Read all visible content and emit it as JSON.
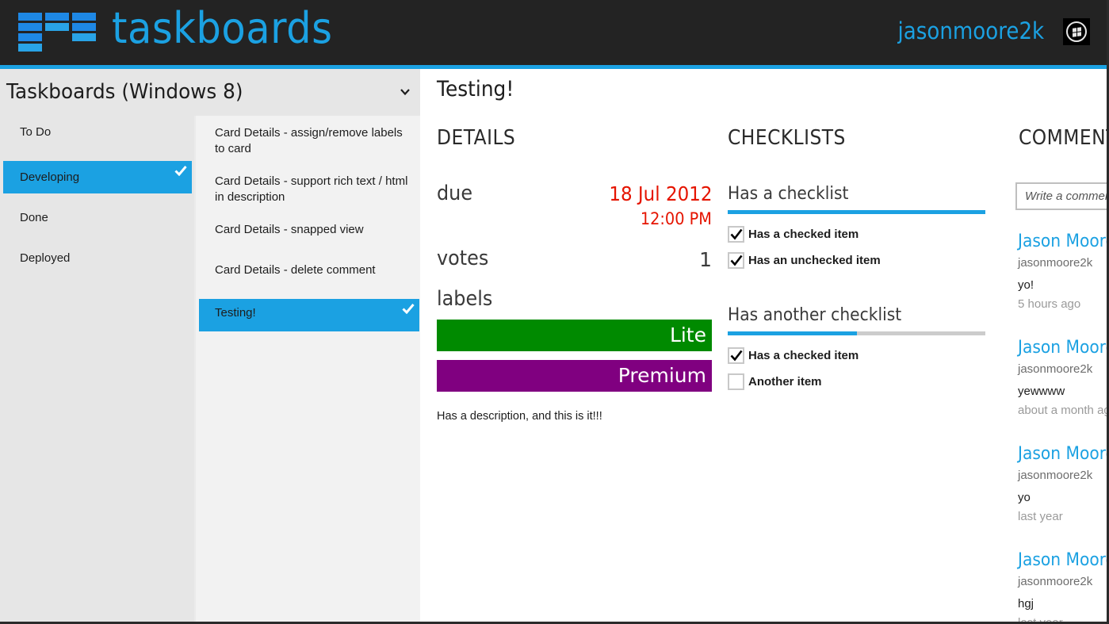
{
  "header": {
    "app_title": "taskboards",
    "username": "jasonmoore2k",
    "accent_color": "#1ba1e2",
    "avatar_icon": "windows-logo-icon"
  },
  "board": {
    "title": "Taskboards (Windows 8)",
    "dropdown_icon": "chevron-down-icon"
  },
  "lists": [
    {
      "label": "To Do",
      "selected": false
    },
    {
      "label": "Developing",
      "selected": true
    },
    {
      "label": "Done",
      "selected": false
    },
    {
      "label": "Deployed",
      "selected": false
    }
  ],
  "cards": [
    {
      "label": "Card Details - assign/remove labels to card",
      "selected": false
    },
    {
      "label": "Card Details - support rich text / html in description",
      "selected": false
    },
    {
      "label": "Card Details - snapped view",
      "selected": false
    },
    {
      "label": "Card Details - delete comment",
      "selected": false
    },
    {
      "label": "Testing!",
      "selected": true
    }
  ],
  "card": {
    "title": "Testing!",
    "details_heading": "DETAILS",
    "due_label": "due",
    "due_date": "18 Jul 2012",
    "due_time": "12:00 PM",
    "due_color": "#e51400",
    "votes_label": "votes",
    "votes": "1",
    "labels_label": "labels",
    "labels": [
      {
        "name": "Lite",
        "color": "#008a00"
      },
      {
        "name": "Premium",
        "color": "#800080"
      }
    ],
    "description": "Has a description, and this is it!!!"
  },
  "checklists": {
    "heading": "CHECKLISTS",
    "items": [
      {
        "title": "Has a checklist",
        "progress_percent": 100,
        "entries": [
          {
            "label": "Has a checked item",
            "checked": true
          },
          {
            "label": "Has an unchecked item",
            "checked": true
          }
        ]
      },
      {
        "title": "Has another checklist",
        "progress_percent": 50,
        "entries": [
          {
            "label": "Has a checked item",
            "checked": true
          },
          {
            "label": "Another item",
            "checked": false
          }
        ]
      }
    ]
  },
  "comments": {
    "heading": "COMMENTS",
    "input_placeholder": "Write a comment",
    "items": [
      {
        "author": "Jason Moore",
        "handle": "jasonmoore2k",
        "text": "yo!",
        "time": "5 hours ago"
      },
      {
        "author": "Jason Moore",
        "handle": "jasonmoore2k",
        "text": "yewwww",
        "time": "about a month ago"
      },
      {
        "author": "Jason Moore",
        "handle": "jasonmoore2k",
        "text": "yo",
        "time": "last year"
      },
      {
        "author": "Jason Moore",
        "handle": "jasonmoore2k",
        "text": "hgj",
        "time": "last year"
      }
    ]
  }
}
